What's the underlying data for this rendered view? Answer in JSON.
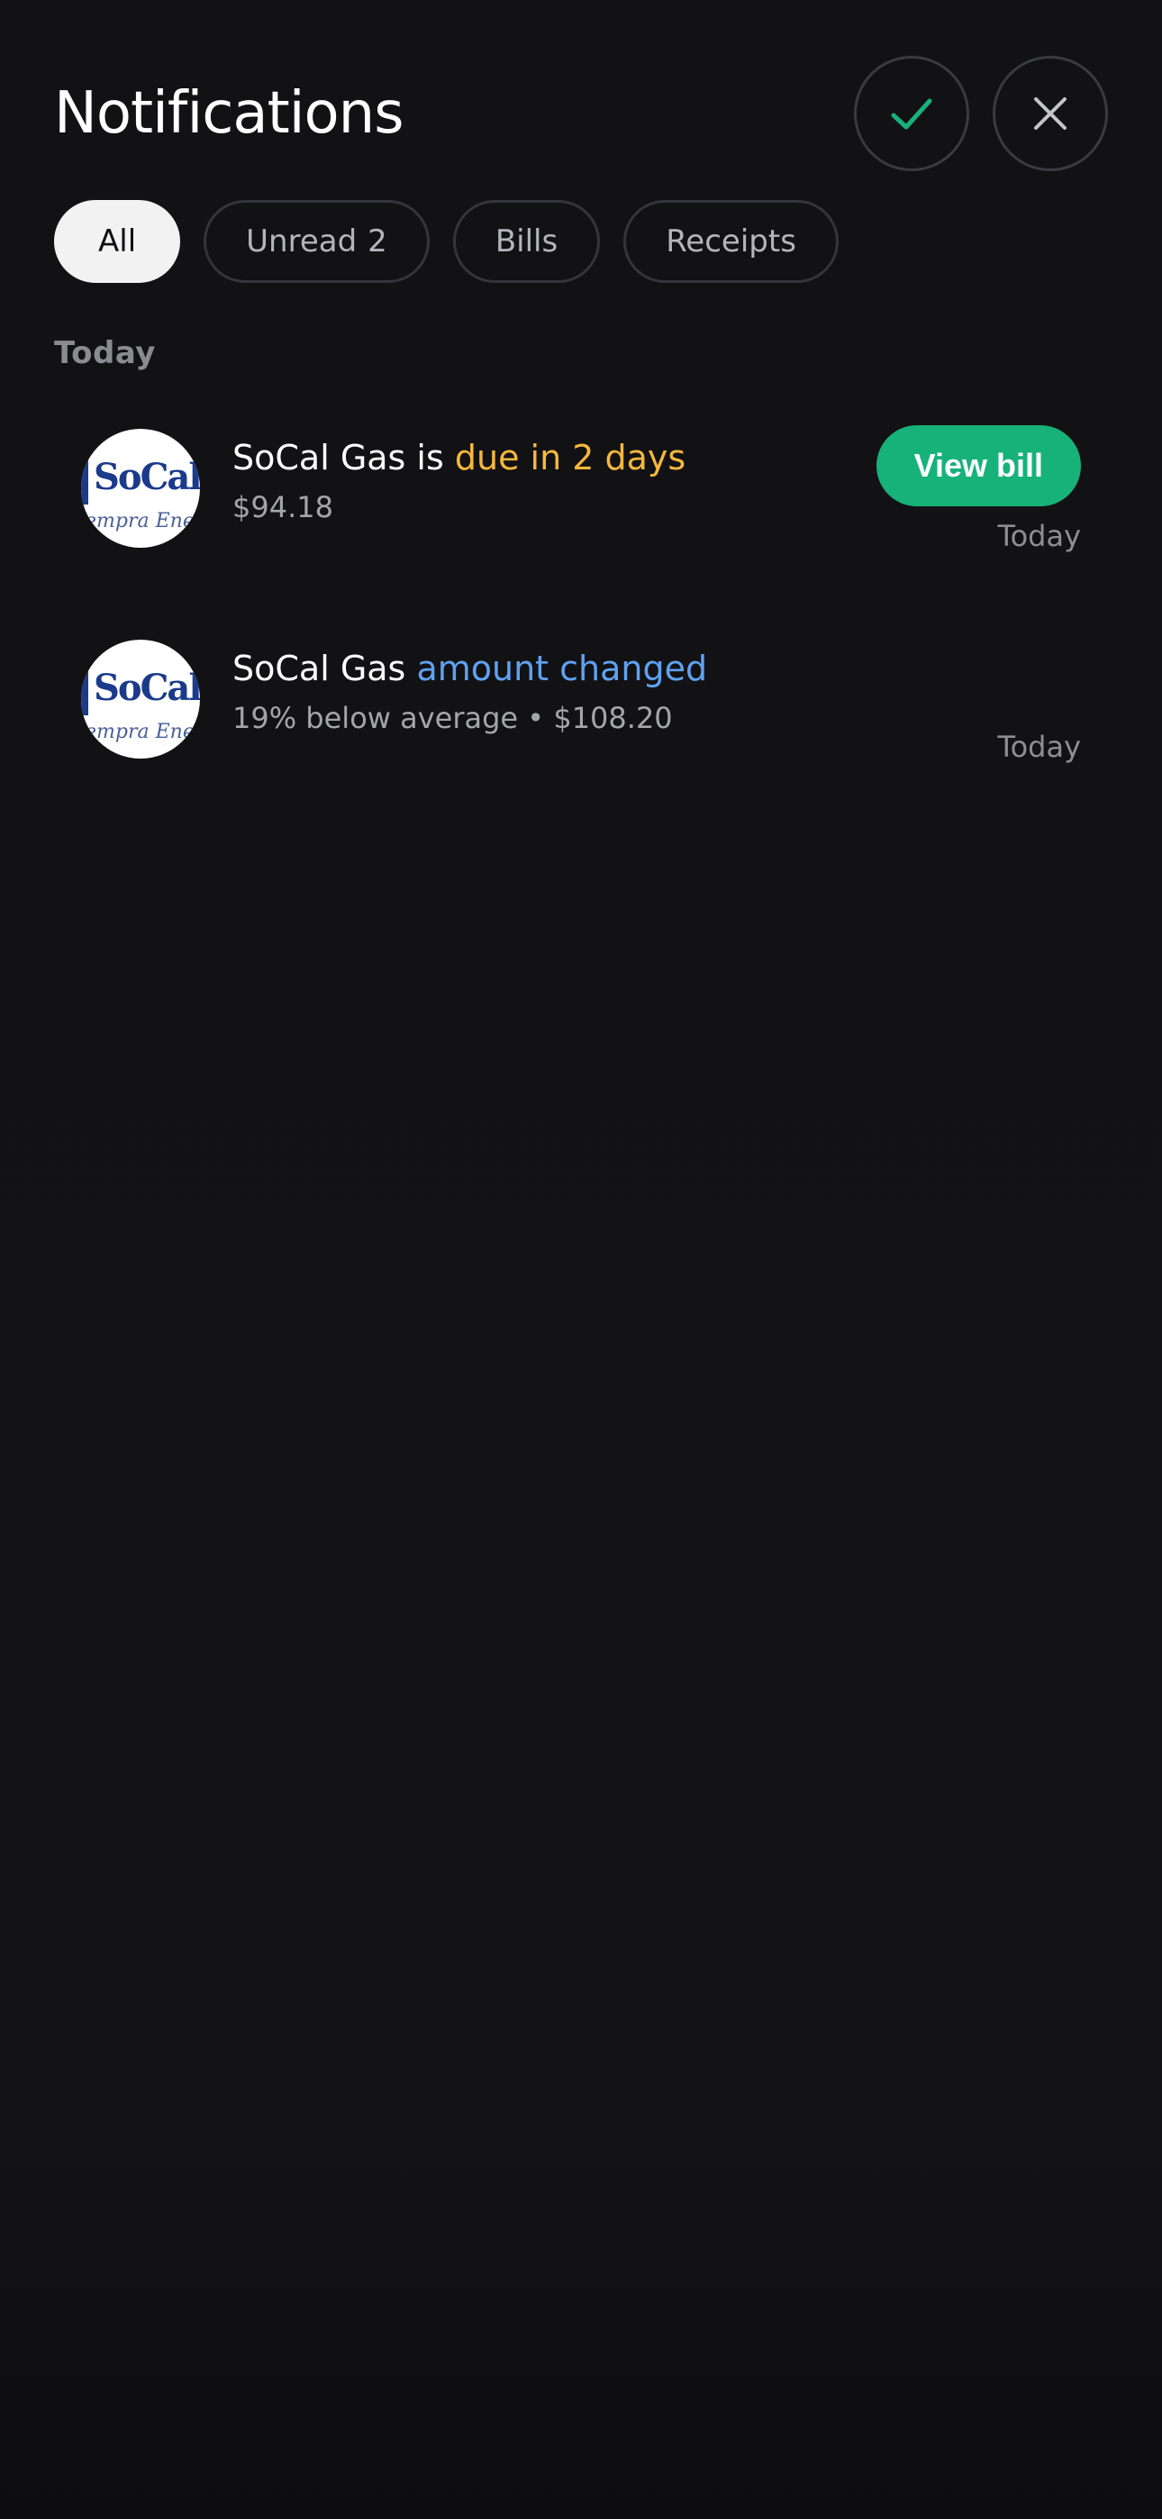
{
  "header": {
    "title": "Notifications"
  },
  "filters": [
    {
      "label": "All",
      "active": true
    },
    {
      "label": "Unread",
      "count": "2",
      "active": false
    },
    {
      "label": "Bills",
      "active": false
    },
    {
      "label": "Receipts",
      "active": false
    }
  ],
  "section": {
    "label": "Today"
  },
  "notifications": [
    {
      "logo_text": "SoCalG",
      "logo_sub": "empra Ener",
      "title_prefix": "SoCal Gas is ",
      "title_highlight": "due in 2 days",
      "subtitle": "$94.18",
      "action_label": "View bill",
      "time": "Today"
    },
    {
      "logo_text": "SoCalG",
      "logo_sub": "empra Ener",
      "title_prefix": "SoCal Gas ",
      "title_highlight": "amount changed",
      "subtitle": "19% below average • $108.20",
      "time": "Today"
    }
  ],
  "colors": {
    "background": "#121214",
    "accent_green": "#17b27a",
    "highlight_yellow": "#f6b73c",
    "highlight_blue": "#5fa2f0",
    "logo_blue": "#1b3a8c"
  },
  "icons": {
    "mark_all_read": "check-icon",
    "close": "close-icon"
  }
}
